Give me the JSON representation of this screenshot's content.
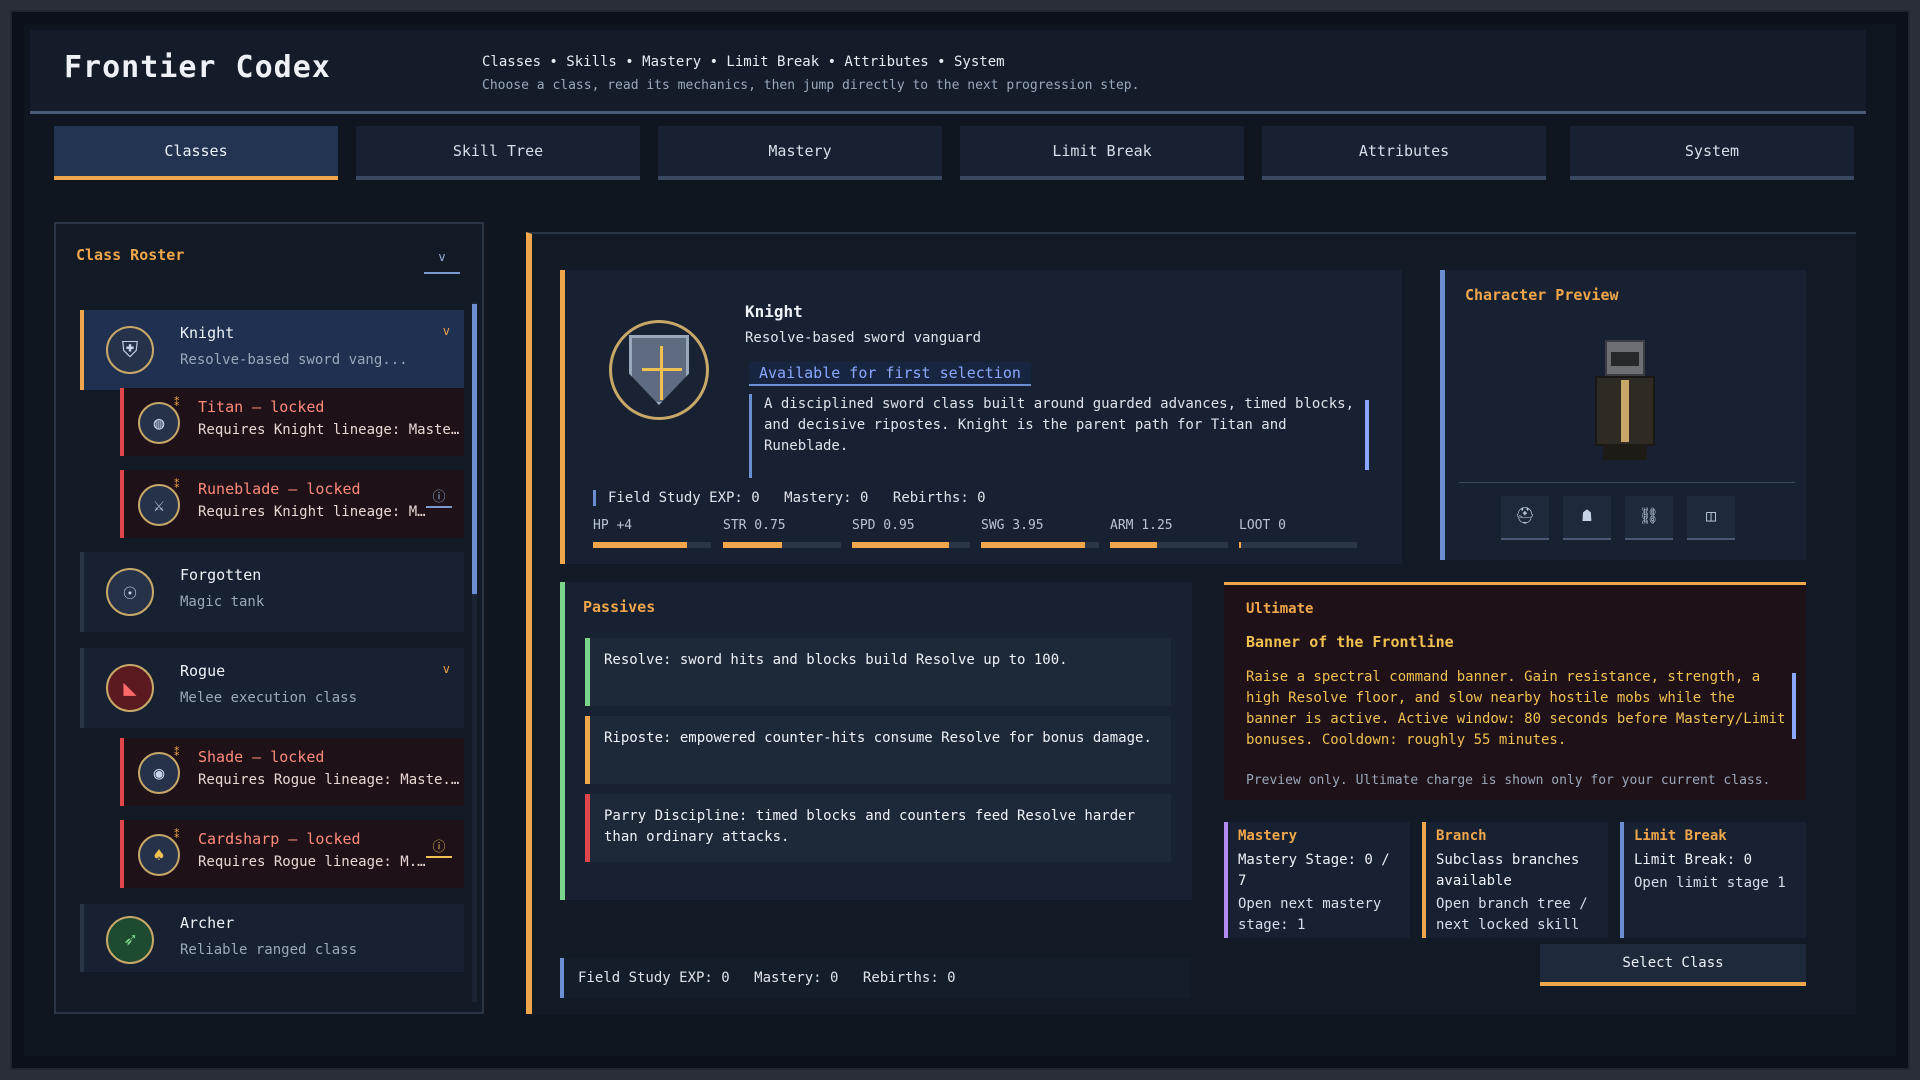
{
  "header": {
    "title": "Frontier Codex",
    "breadcrumb": "Classes • Skills • Mastery • Limit Break • Attributes • System",
    "subtitle": "Choose a class, read its mechanics, then jump directly to the next progression step."
  },
  "tabs": [
    "Classes",
    "Skill Tree",
    "Mastery",
    "Limit Break",
    "Attributes",
    "System"
  ],
  "roster": {
    "title": "Class Roster",
    "collapse_label": "v",
    "items": [
      {
        "name": "Knight",
        "desc": "Resolve-based sword vang...",
        "icon": "⛨",
        "chevron": "v"
      },
      {
        "name": "Titan — locked",
        "desc": "Requires Knight lineage: Maste...",
        "icon": "◍",
        "lock": "⁑"
      },
      {
        "name": "Runeblade — locked",
        "desc": "Requires Knight lineage: M...",
        "icon": "⚔",
        "lock": "⁑",
        "info": "ⓘ"
      },
      {
        "name": "Forgotten",
        "desc": "Magic tank",
        "icon": "☉"
      },
      {
        "name": "Rogue",
        "desc": "Melee execution class",
        "icon": "◣",
        "chevron": "v"
      },
      {
        "name": "Shade — locked",
        "desc": "Requires Rogue lineage: Maste...",
        "icon": "◉",
        "lock": "⁑"
      },
      {
        "name": "Cardsharp — locked",
        "desc": "Requires Rogue lineage: M...",
        "icon": "♠",
        "lock": "⁑",
        "info": "ⓘ"
      },
      {
        "name": "Archer",
        "desc": "Reliable ranged class",
        "icon": "➶"
      }
    ]
  },
  "detail": {
    "name": "Knight",
    "tagline": "Resolve-based sword vanguard",
    "availability": "Available for first selection",
    "blurb": "A disciplined sword class built around guarded advances, timed blocks, and decisive ripostes. Knight is the parent path for Titan and Runeblade.",
    "stats_line": {
      "exp": "Field Study EXP: 0",
      "mastery": "Mastery: 0",
      "rebirths": "Rebirths: 0"
    },
    "stats": [
      {
        "label": "HP +4",
        "fill": 0.8
      },
      {
        "label": "STR 0.75",
        "fill": 0.5
      },
      {
        "label": "SPD 0.95",
        "fill": 0.82
      },
      {
        "label": "SWG 3.95",
        "fill": 0.88
      },
      {
        "label": "ARM 1.25",
        "fill": 0.4
      },
      {
        "label": "LOOT 0",
        "fill": 0.02
      }
    ]
  },
  "preview": {
    "title": "Character Preview",
    "slots": [
      "⛑",
      "☗",
      "⛓",
      "◫"
    ]
  },
  "passives": {
    "title": "Passives",
    "items": [
      "Resolve: sword hits and blocks build Resolve up to 100.",
      "Riposte: empowered counter-hits consume Resolve for bonus damage.",
      "Parry Discipline: timed blocks and counters feed Resolve harder than ordinary attacks."
    ]
  },
  "ultimate": {
    "title": "Ultimate",
    "name": "Banner of the Frontline",
    "desc": "Raise a spectral command banner. Gain resistance, strength, a high Resolve floor, and slow nearby hostile mobs while the banner is active. Active window: 80 seconds before Mastery/Limit bonuses. Cooldown: roughly 55 minutes.",
    "note": "Preview only. Ultimate charge is shown only for your current class."
  },
  "progression": {
    "mastery": {
      "title": "Mastery",
      "line": "Mastery Stage: 0 / 7",
      "link": "Open next mastery stage: 1"
    },
    "branch": {
      "title": "Branch",
      "line": "Subclass branches available",
      "link": "Open branch tree / next locked skill"
    },
    "limit": {
      "title": "Limit Break",
      "line": "Limit Break: 0",
      "link": "Open limit stage 1"
    }
  },
  "select_label": "Select Class",
  "footer": {
    "exp": "Field Study EXP: 0",
    "mastery": "Mastery: 0",
    "rebirths": "Rebirths: 0"
  },
  "colors": {
    "accent": "#f0a64a",
    "info": "#6c8fd4",
    "locked": "#e0464a",
    "passive": "#7ad48a"
  }
}
